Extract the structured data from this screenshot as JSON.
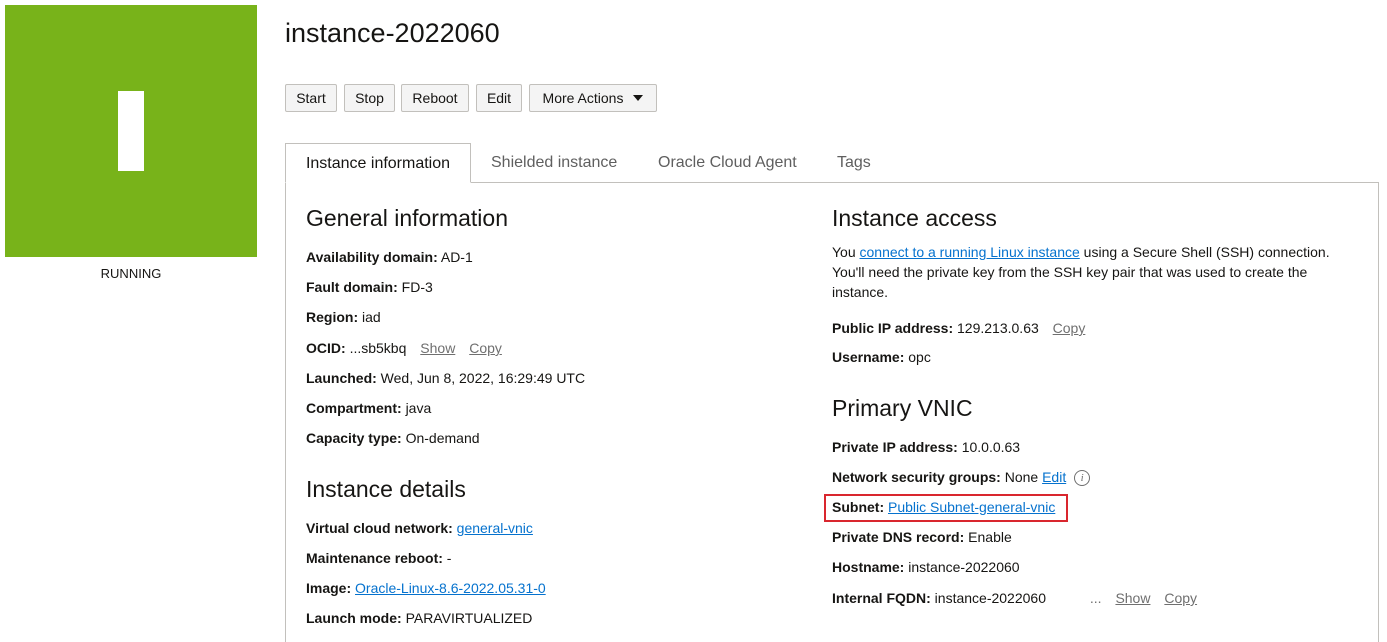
{
  "status": {
    "glyph": "I",
    "label": "RUNNING",
    "color": "#78b31a"
  },
  "instance_name": "instance-2022060",
  "toolbar": {
    "start": "Start",
    "stop": "Stop",
    "reboot": "Reboot",
    "edit": "Edit",
    "more_actions": "More Actions"
  },
  "tabs": [
    {
      "label": "Instance information",
      "active": true
    },
    {
      "label": "Shielded instance",
      "active": false
    },
    {
      "label": "Oracle Cloud Agent",
      "active": false
    },
    {
      "label": "Tags",
      "active": false
    }
  ],
  "general": {
    "heading": "General information",
    "availability_domain": {
      "label": "Availability domain:",
      "value": "AD-1"
    },
    "fault_domain": {
      "label": "Fault domain:",
      "value": "FD-3"
    },
    "region": {
      "label": "Region:",
      "value": "iad"
    },
    "ocid": {
      "label": "OCID:",
      "value": "...sb5kbq",
      "show": "Show",
      "copy": "Copy"
    },
    "launched": {
      "label": "Launched:",
      "value": "Wed, Jun 8, 2022, 16:29:49 UTC"
    },
    "compartment": {
      "label": "Compartment:",
      "value": "java"
    },
    "capacity_type": {
      "label": "Capacity type:",
      "value": "On-demand"
    }
  },
  "details": {
    "heading": "Instance details",
    "vcn": {
      "label": "Virtual cloud network:",
      "value": "general-vnic"
    },
    "maintenance_reboot": {
      "label": "Maintenance reboot:",
      "value": "-"
    },
    "image": {
      "label": "Image:",
      "value": "Oracle-Linux-8.6-2022.05.31-0"
    },
    "launch_mode": {
      "label": "Launch mode:",
      "value": "PARAVIRTUALIZED"
    }
  },
  "access": {
    "heading": "Instance access",
    "intro_prefix": "You ",
    "intro_link": "connect to a running Linux instance",
    "intro_suffix": " using a Secure Shell (SSH) connection. You'll need the private key from the SSH key pair that was used to create the instance.",
    "public_ip": {
      "label": "Public IP address:",
      "value": "129.213.0.63",
      "copy": "Copy"
    },
    "username": {
      "label": "Username:",
      "value": "opc"
    }
  },
  "vnic": {
    "heading": "Primary VNIC",
    "private_ip": {
      "label": "Private IP address:",
      "value": "10.0.0.63"
    },
    "nsg": {
      "label": "Network security groups:",
      "value": "None",
      "edit": "Edit",
      "info_glyph": "i"
    },
    "subnet": {
      "label": "Subnet:",
      "value": "Public Subnet-general-vnic"
    },
    "private_dns": {
      "label": "Private DNS record:",
      "value": "Enable"
    },
    "hostname": {
      "label": "Hostname:",
      "value": "instance-2022060"
    },
    "fqdn": {
      "label": "Internal FQDN:",
      "value": "instance-2022060",
      "ellipsis": "...",
      "show": "Show",
      "copy": "Copy"
    }
  },
  "highlight_color": "#d9262e",
  "link_color": "#0572ce"
}
